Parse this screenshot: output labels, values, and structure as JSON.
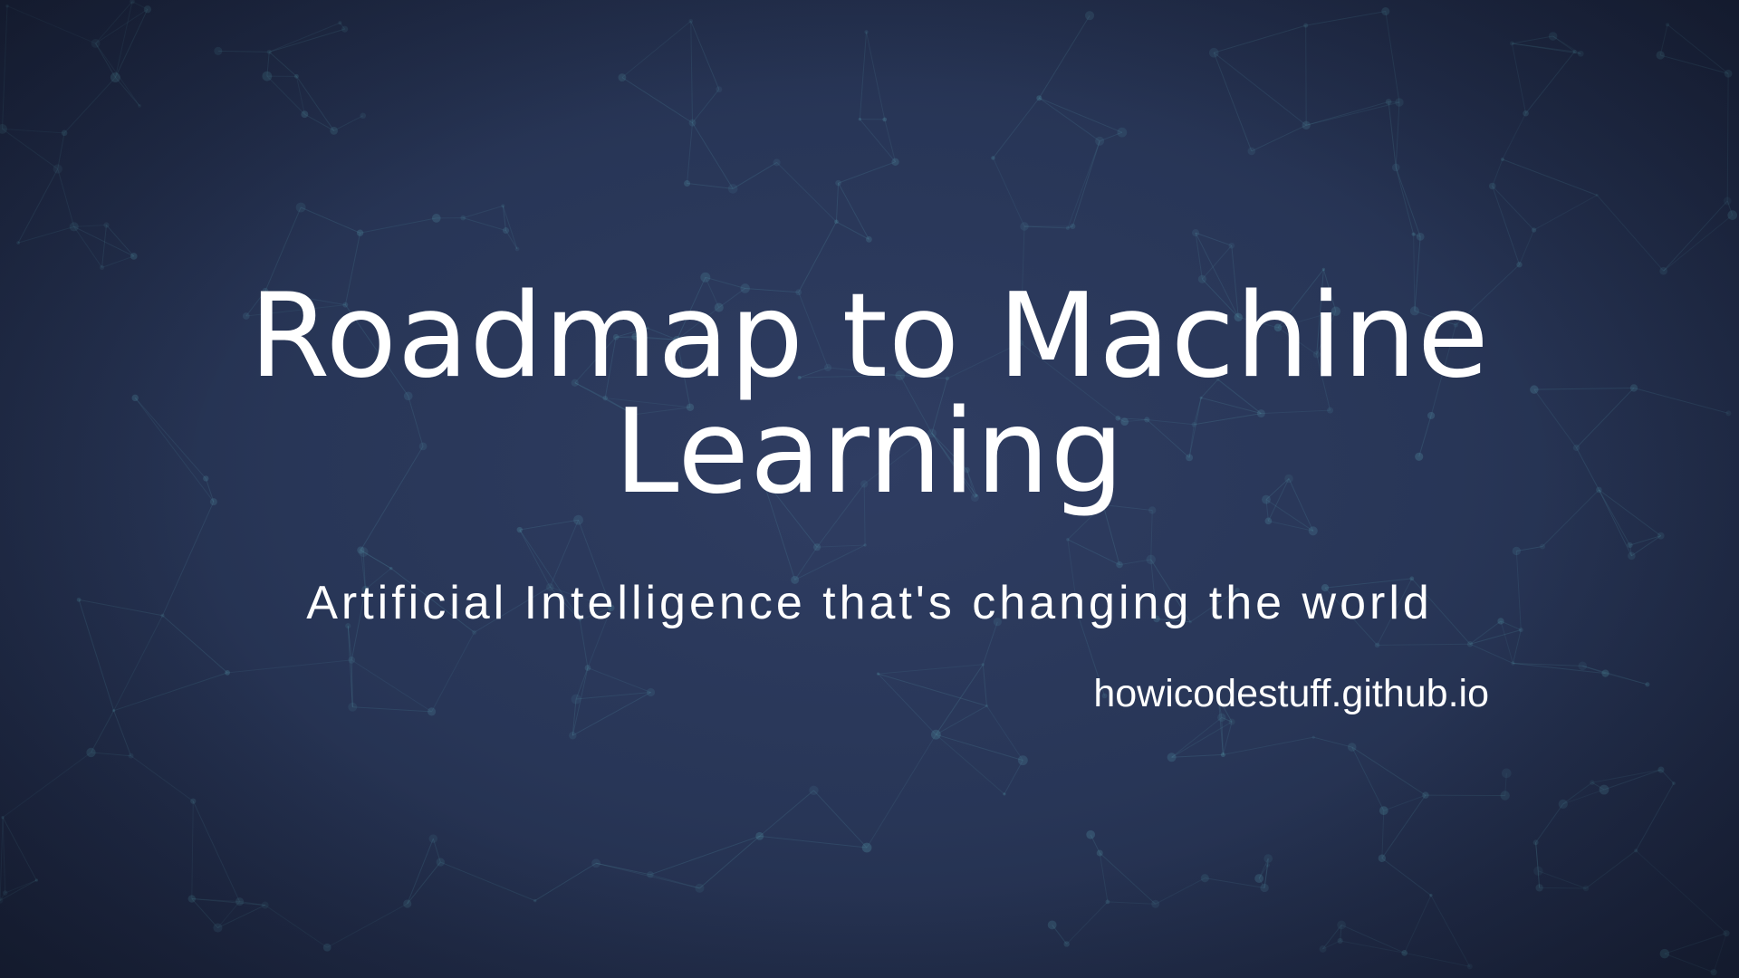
{
  "slide": {
    "title_line_1": "Roadmap to Machine",
    "title_line_2": "Learning",
    "subtitle": "Artificial Intelligence that's changing the world",
    "url": "howicodestuff.github.io"
  },
  "colors": {
    "background": "#283657",
    "background_edge": "#1a2238",
    "text": "#ffffff",
    "network_lines": "#5fa8b8"
  }
}
